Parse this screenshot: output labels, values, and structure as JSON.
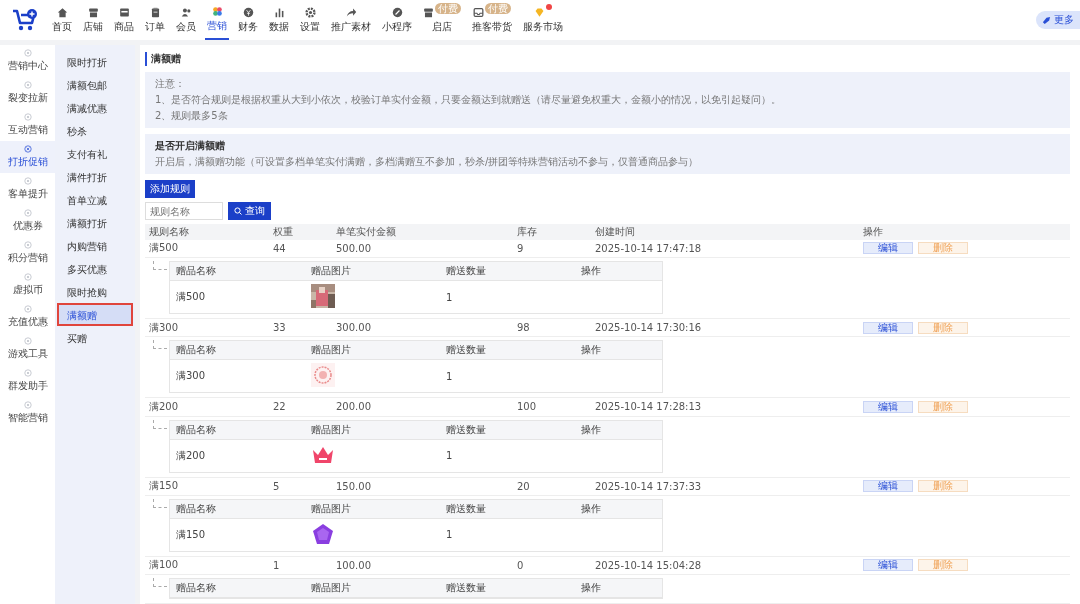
{
  "nav": [
    {
      "label": "首页",
      "selected": false
    },
    {
      "label": "店铺",
      "selected": false
    },
    {
      "label": "商品",
      "selected": false
    },
    {
      "label": "订单",
      "selected": false
    },
    {
      "label": "会员",
      "selected": false
    },
    {
      "label": "营销",
      "selected": true
    },
    {
      "label": "财务",
      "selected": false
    },
    {
      "label": "数据",
      "selected": false
    },
    {
      "label": "设置",
      "selected": false
    },
    {
      "label": "推广素材",
      "selected": false
    },
    {
      "label": "小程序",
      "selected": false
    },
    {
      "label": "启店",
      "selected": false,
      "badge": "付费"
    },
    {
      "label": "推客带货",
      "selected": false,
      "badge": "付费"
    },
    {
      "label": "服务市场",
      "selected": false,
      "dot": true
    }
  ],
  "more_button": {
    "label": "更多"
  },
  "sidebar": {
    "items": [
      {
        "label": "营销中心",
        "selected": false
      },
      {
        "label": "裂变拉新",
        "selected": false
      },
      {
        "label": "互动营销",
        "selected": false
      },
      {
        "label": "打折促销",
        "selected": true
      },
      {
        "label": "客单提升",
        "selected": false
      },
      {
        "label": "优惠券",
        "selected": false
      },
      {
        "label": "积分营销",
        "selected": false
      },
      {
        "label": "虚拟币",
        "selected": false
      },
      {
        "label": "充值优惠",
        "selected": false
      },
      {
        "label": "游戏工具",
        "selected": false
      },
      {
        "label": "群发助手",
        "selected": false
      },
      {
        "label": "智能营销",
        "selected": false
      }
    ]
  },
  "submenu": {
    "items": [
      {
        "label": "限时打折",
        "selected": false
      },
      {
        "label": "满额包邮",
        "selected": false
      },
      {
        "label": "满减优惠",
        "selected": false
      },
      {
        "label": "秒杀",
        "selected": false
      },
      {
        "label": "支付有礼",
        "selected": false
      },
      {
        "label": "满件打折",
        "selected": false
      },
      {
        "label": "首单立减",
        "selected": false
      },
      {
        "label": "满额打折",
        "selected": false
      },
      {
        "label": "内购营销",
        "selected": false
      },
      {
        "label": "多买优惠",
        "selected": false
      },
      {
        "label": "限时抢购",
        "selected": false
      },
      {
        "label": "满额赠",
        "selected": true,
        "highlighted": true
      },
      {
        "label": "买赠",
        "selected": false
      }
    ]
  },
  "page_title": "满额赠",
  "notice": {
    "title": "注意：",
    "lines": [
      "1、是否符合规则是根据权重从大到小依次，校验订单实付金额，只要金额达到就赠送（请尽量避免权重大，金额小的情况，以免引起疑问）。",
      "2、规则最多5条"
    ]
  },
  "switch_panel": {
    "title": "是否开启满额赠",
    "description": "开启后，满额赠功能（可设置多档单笔实付满赠，多档满赠互不参加，秒杀/拼团等特殊营销活动不参与，仅普通商品参与）"
  },
  "add_button": "添加规则",
  "search": {
    "placeholder": "规则名称",
    "button": "查询"
  },
  "table": {
    "columns": [
      "规则名称",
      "权重",
      "单笔实付金额",
      "库存",
      "创建时间",
      "操作"
    ],
    "rows": [
      {
        "cells": [
          "满500",
          "44",
          "500.00",
          "9",
          "2025-10-14 17:47:18"
        ],
        "actions": [
          "编辑",
          "删除"
        ],
        "gift_columns": [
          "赠品名称",
          "赠品图片",
          "赠送数量",
          "操作"
        ],
        "gifts": [
          {
            "name": "满500",
            "quantity": "1"
          }
        ]
      },
      {
        "cells": [
          "满300",
          "33",
          "300.00",
          "98",
          "2025-10-14 17:30:16"
        ],
        "actions": [
          "编辑",
          "删除"
        ],
        "gift_columns": [
          "赠品名称",
          "赠品图片",
          "赠送数量",
          "操作"
        ],
        "gifts": [
          {
            "name": "满300",
            "quantity": "1"
          }
        ]
      },
      {
        "cells": [
          "满200",
          "22",
          "200.00",
          "100",
          "2025-10-14 17:28:13"
        ],
        "actions": [
          "编辑",
          "删除"
        ],
        "gift_columns": [
          "赠品名称",
          "赠品图片",
          "赠送数量",
          "操作"
        ],
        "gifts": [
          {
            "name": "满200",
            "quantity": "1"
          }
        ]
      },
      {
        "cells": [
          "满150",
          "5",
          "150.00",
          "20",
          "2025-10-14 17:37:33"
        ],
        "actions": [
          "编辑",
          "删除"
        ],
        "gift_columns": [
          "赠品名称",
          "赠品图片",
          "赠送数量",
          "操作"
        ],
        "gifts": [
          {
            "name": "满150",
            "quantity": "1"
          }
        ]
      },
      {
        "cells": [
          "满100",
          "1",
          "100.00",
          "0",
          "2025-10-14 15:04:28"
        ],
        "actions": [
          "编辑",
          "删除"
        ],
        "gift_columns": [
          "赠品名称",
          "赠品图片",
          "赠送数量",
          "操作"
        ]
      }
    ]
  }
}
